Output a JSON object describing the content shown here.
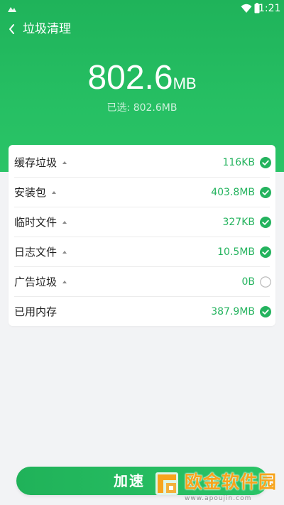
{
  "status_bar": {
    "time": "1:21"
  },
  "header": {
    "title": "垃圾清理",
    "back_icon": "chevron-left-icon"
  },
  "summary": {
    "total_value": "802.6",
    "total_unit": "MB",
    "selected_text": "已选: 802.6MB"
  },
  "items": [
    {
      "label": "缓存垃圾",
      "size": "116KB",
      "checked": true,
      "expandable": true
    },
    {
      "label": "安装包",
      "size": "403.8MB",
      "checked": true,
      "expandable": true
    },
    {
      "label": "临时文件",
      "size": "327KB",
      "checked": true,
      "expandable": true
    },
    {
      "label": "日志文件",
      "size": "10.5MB",
      "checked": true,
      "expandable": true
    },
    {
      "label": "广告垃圾",
      "size": "0B",
      "checked": false,
      "expandable": true
    },
    {
      "label": "已用内存",
      "size": "387.9MB",
      "checked": true,
      "expandable": false
    }
  ],
  "action": {
    "button_label": "加速"
  },
  "watermark": {
    "text": "欧金软件园",
    "url": "www.apoujin.com"
  },
  "colors": {
    "accent": "#26bf63",
    "check": "#24b35e",
    "background": "#f2f3f5"
  }
}
